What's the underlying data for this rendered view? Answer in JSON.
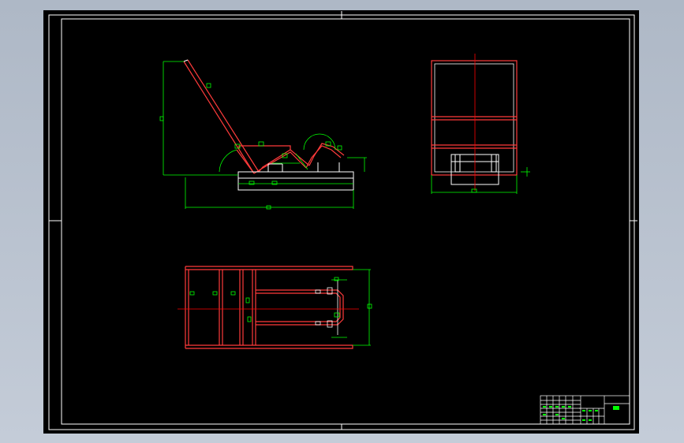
{
  "drawing": {
    "background": "#000000",
    "frame_color": "#ffffff",
    "part_color": "#ff0000",
    "part_inner_color": "#ffffff",
    "dimension_color": "#00ff00",
    "centerline_color": "#ff0000"
  },
  "views": {
    "side_view": "side-view",
    "end_view": "end-view",
    "top_view": "top-view"
  },
  "title_block": {
    "name_cell": "",
    "corner_mark": "(I)"
  }
}
